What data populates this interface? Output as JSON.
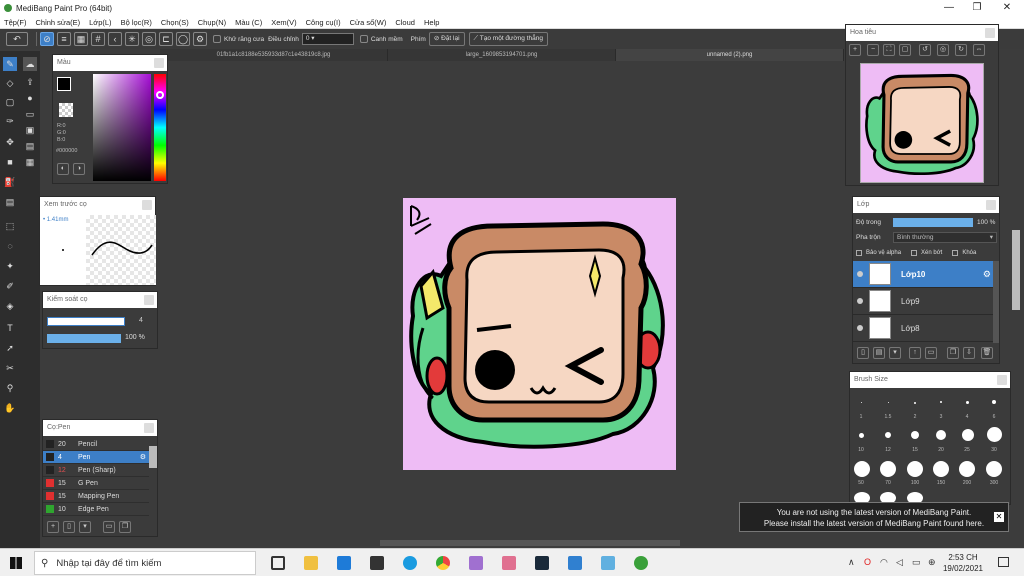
{
  "window": {
    "title": "MediBang Paint Pro (64bit)"
  },
  "menu": [
    "Tệp(F)",
    "Chỉnh sửa(E)",
    "Lớp(L)",
    "Bộ lọc(R)",
    "Chọn(S)",
    "Chụp(N)",
    "Màu (C)",
    "Xem(V)",
    "Công cụ(I)",
    "Cửa sổ(W)",
    "Cloud",
    "Help"
  ],
  "toolbar": {
    "antialias_label": "Khử răng cưa",
    "adjust_label": "Điều chỉnh",
    "adjust_value": "0",
    "smooth_label": "Canh mềm",
    "pen_label": "Phím",
    "set_button": "Đặt lại",
    "create_line_button": "Tạo một đường thẳng"
  },
  "file_tabs": [
    "01fb1a1c8188e535933d87c1e43819c8.jpg",
    "large_1609853194701.png",
    "unnamed (2).png"
  ],
  "color_panel": {
    "title": "Màu",
    "r": "R:0",
    "g": "G:0",
    "b": "B:0",
    "hex": "#000000"
  },
  "brush_preview": {
    "title": "Xem trước cọ",
    "size": "1.41mm"
  },
  "brush_control": {
    "title": "Kiểm soát cọ",
    "size_value": "4",
    "opacity_value": "100 %"
  },
  "brush_list": {
    "title": "Cọ:Pen",
    "items": [
      {
        "size": "20",
        "name": "Pencil",
        "color": "#222222"
      },
      {
        "size": "4",
        "name": "Pen",
        "color": "#222222"
      },
      {
        "size": "12",
        "name": "Pen (Sharp)",
        "color": "#222222"
      },
      {
        "size": "15",
        "name": "G Pen",
        "color": "#e03030"
      },
      {
        "size": "15",
        "name": "Mapping Pen",
        "color": "#e03030"
      },
      {
        "size": "10",
        "name": "Edge Pen",
        "color": "#2fa52f"
      }
    ]
  },
  "navigator": {
    "title": "Hoa tiêu"
  },
  "layers": {
    "title": "Lớp",
    "opacity_label": "Độ trong",
    "opacity_value": "100 %",
    "blend_label": "Pha trộn",
    "blend_value": "Bình thường",
    "protect_alpha": "Bảo vệ alpha",
    "clipping": "Xén bớt",
    "lock": "Khóa",
    "items": [
      "Lớp10",
      "Lớp9",
      "Lớp8"
    ]
  },
  "brush_size": {
    "title": "Brush Size",
    "labels": [
      "1",
      "1.5",
      "2",
      "3",
      "4",
      "6",
      "10",
      "12",
      "15",
      "20",
      "25",
      "30",
      "50",
      "70",
      "100",
      "150",
      "200",
      "300"
    ]
  },
  "notice": {
    "line1": "You are not using the latest version of MediBang Paint.",
    "line2": "Please install the latest version of MediBang Paint found here."
  },
  "taskbar": {
    "search_placeholder": "Nhập tại đây để tìm kiếm",
    "time": "2:53 CH",
    "date": "19/02/2021"
  }
}
